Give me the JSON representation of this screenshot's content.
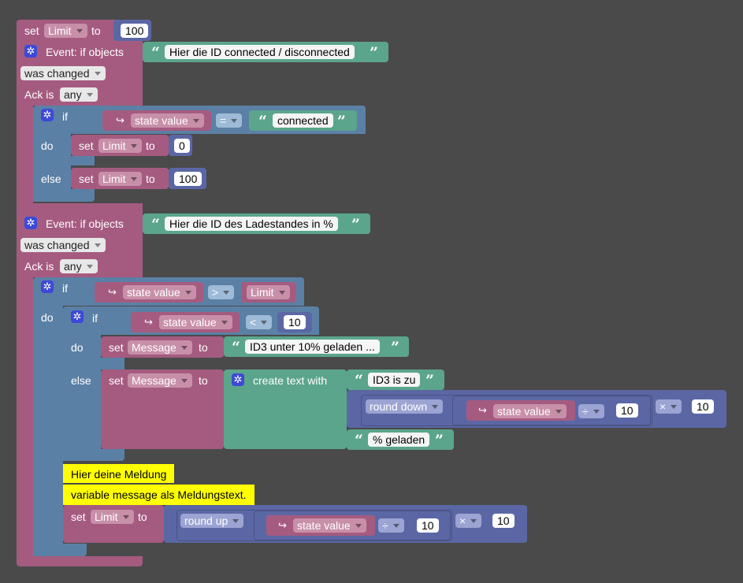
{
  "blocks": {
    "set1": {
      "set": "set",
      "var": "Limit",
      "to": "to",
      "value": "100"
    },
    "event1": {
      "title": "Event: if objects",
      "id_text": "Hier die ID connected / disconnected",
      "changed": "was changed",
      "ack_label": "Ack is",
      "ack_value": "any",
      "if_label": "if",
      "do_label": "do",
      "else_label": "else",
      "state": "state value",
      "op": "=",
      "compare_text": "connected",
      "set_do": {
        "set": "set",
        "var": "Limit",
        "to": "to",
        "value": "0"
      },
      "set_else": {
        "set": "set",
        "var": "Limit",
        "to": "to",
        "value": "100"
      }
    },
    "event2": {
      "title": "Event: if objects",
      "id_text": "Hier die ID des Ladestandes in %",
      "changed": "was changed",
      "ack_label": "Ack is",
      "ack_value": "any",
      "if_label": "if",
      "do_label": "do",
      "state": "state value",
      "op_gt": ">",
      "limit_var": "Limit",
      "inner_if": {
        "if_label": "if",
        "do_label": "do",
        "else_label": "else",
        "state": "state value",
        "op_lt": "<",
        "threshold": "10",
        "set_do": {
          "set": "set",
          "var": "Message",
          "to": "to",
          "text": "ID3 unter 10% geladen ..."
        },
        "set_else": {
          "set": "set",
          "var": "Message",
          "to": "to",
          "create_text": "create text with",
          "text1": "ID3 is zu",
          "round": "round down",
          "state": "state value",
          "div_op": "÷",
          "div_val": "10",
          "mul_op": "×",
          "mul_val": "10",
          "text2": "% geladen"
        }
      },
      "note1": "Hier deine Meldung",
      "note2": "variable message als Meldungstext.",
      "set_limit": {
        "set": "set",
        "var": "Limit",
        "to": "to",
        "round": "round up",
        "state": "state value",
        "div_op": "÷",
        "div_val": "10",
        "mul_op": "×",
        "mul_val": "10"
      }
    }
  },
  "colors": {
    "background": "#4a4a4a",
    "variable": "#a55b80",
    "logic": "#5b80a5",
    "text": "#5ba58c",
    "math": "#5b67a5",
    "note": "#ffff00"
  },
  "icons": {
    "gear": "gear-icon",
    "arrow": "state-arrow-icon"
  }
}
